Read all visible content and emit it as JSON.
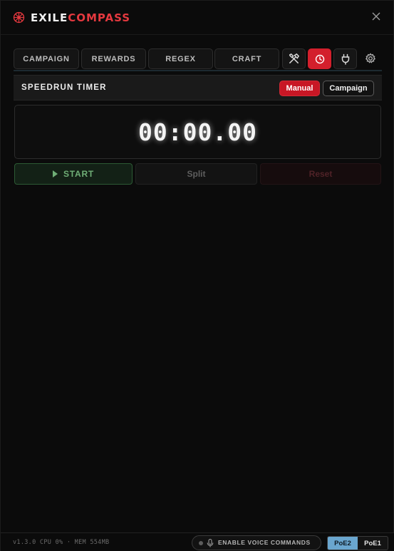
{
  "app": {
    "brand_first": "EXILE",
    "brand_second": "COMPASS",
    "brand_white_color": "#f2f2f2",
    "brand_red_color": "#e5393f",
    "accent_color": "#d31f2c"
  },
  "tabs": [
    {
      "label": "CAMPAIGN"
    },
    {
      "label": "REWARDS"
    },
    {
      "label": "REGEX"
    },
    {
      "label": "CRAFT"
    }
  ],
  "icon_tabs": [
    {
      "icon": "tools-icon",
      "active": false
    },
    {
      "icon": "clock-icon",
      "active": true
    },
    {
      "icon": "plug-icon",
      "active": false
    },
    {
      "icon": "gear-icon",
      "active": false
    }
  ],
  "section": {
    "title": "SPEEDRUN TIMER",
    "modes": [
      "Manual",
      "Campaign"
    ],
    "selected_mode": "Manual"
  },
  "timer": {
    "display": "00:00.00"
  },
  "controls": {
    "start_label": "START",
    "split_label": "Split",
    "reset_label": "Reset",
    "split_enabled": false,
    "reset_enabled": false
  },
  "footer": {
    "status": "v1.3.0  CPU 0% · MEM 554MB",
    "voice_label": "ENABLE VOICE COMMANDS",
    "versions": [
      "PoE2",
      "PoE1"
    ],
    "selected_version": "PoE2"
  }
}
